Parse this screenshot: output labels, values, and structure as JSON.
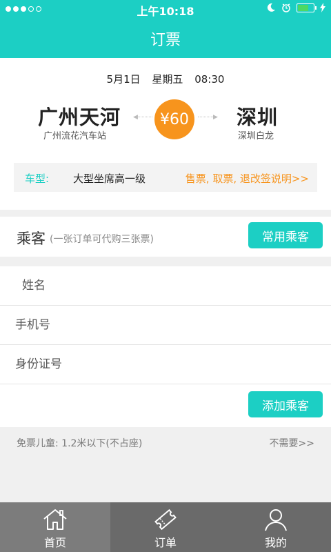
{
  "status_bar": {
    "time": "上午10:18",
    "signal_dots": 5,
    "signal_filled": 3,
    "battery_level": 0.62
  },
  "nav": {
    "title": "订票"
  },
  "trip": {
    "date": "5月1日",
    "weekday": "星期五",
    "time": "08:30",
    "from_city": "广州天河",
    "from_station": "广州流花汽车站",
    "to_city": "深圳",
    "to_station": "深圳白龙",
    "price": "¥60",
    "vehicle_label": "车型:",
    "vehicle_value": "大型坐席高一级",
    "policy_link": "售票, 取票, 退改签说明>>"
  },
  "passenger": {
    "title": "乘客",
    "subtitle": "(一张订单可代购三张票)",
    "common_button": "常用乘客",
    "fields": {
      "name_placeholder": "姓名",
      "phone_placeholder": "手机号",
      "id_placeholder": "身份证号"
    },
    "add_button": "添加乘客"
  },
  "children": {
    "label": "免票儿童: 1.2米以下(不占座)",
    "link": "不需要>>"
  },
  "tabs": [
    {
      "label": "首页",
      "icon": "home-icon",
      "active": true
    },
    {
      "label": "订单",
      "icon": "ticket-icon",
      "active": false
    },
    {
      "label": "我的",
      "icon": "user-icon",
      "active": false
    }
  ],
  "colors": {
    "teal": "#1ccfc4",
    "orange": "#f7941d",
    "tabbar": "#6a6a6a"
  }
}
